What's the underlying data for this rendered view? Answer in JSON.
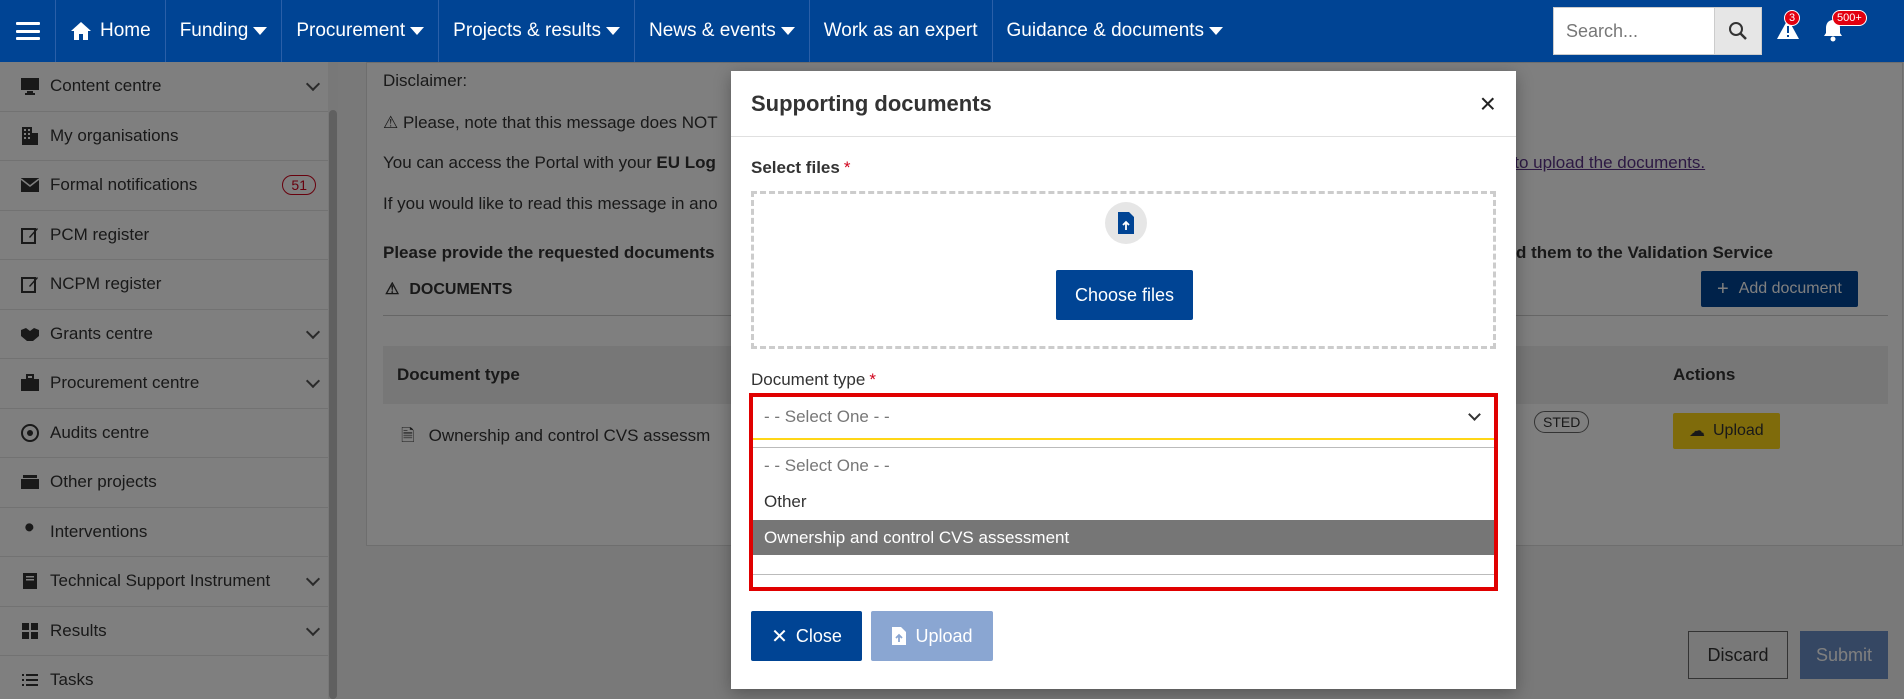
{
  "topnav": {
    "home": "Home",
    "items": [
      "Funding",
      "Procurement",
      "Projects & results",
      "News & events",
      "Work as an expert",
      "Guidance & documents"
    ],
    "search_placeholder": "Search...",
    "alerts_count": "3",
    "notifications_count": "500+"
  },
  "sidebar": {
    "items": [
      {
        "label": "Content centre",
        "icon": "monitor-icon"
      },
      {
        "label": "My organisations",
        "icon": "building-icon"
      },
      {
        "label": "Formal notifications",
        "icon": "envelope-icon",
        "badge": "51"
      },
      {
        "label": "PCM register",
        "icon": "edit-icon"
      },
      {
        "label": "NCPM register",
        "icon": "edit-icon"
      },
      {
        "label": "Grants centre",
        "icon": "handshake-icon"
      },
      {
        "label": "Procurement centre",
        "icon": "briefcase-icon"
      },
      {
        "label": "Audits centre",
        "icon": "target-icon"
      },
      {
        "label": "Other projects",
        "icon": "stack-icon"
      },
      {
        "label": "Interventions",
        "icon": "wrench-icon"
      },
      {
        "label": "Technical Support Instrument",
        "icon": "book-icon"
      },
      {
        "label": "Results",
        "icon": "grid-icon"
      },
      {
        "label": "Tasks",
        "icon": "list-icon"
      }
    ]
  },
  "background": {
    "disclaimer": "Disclaimer:",
    "line1": "⚠ Please, note that this message does NOT",
    "line2_prefix": "You can access the Portal with your ",
    "line2_bold": "EU Log",
    "line2_link": "k to upload the documents.",
    "line3": "If you would like to read this message in ano",
    "request_bold_left": "Please provide the requested documents",
    "request_bold_right": "d them to the Validation Service",
    "documents_heading": "DOCUMENTS",
    "add_document": "Add document",
    "table_col1": "Document type",
    "table_col_actions": "Actions",
    "row_doc": "Ownership and control CVS assessm",
    "row_status": "STED",
    "row_upload": "Upload",
    "discard": "Discard",
    "submit": "Submit"
  },
  "modal": {
    "title": "Supporting documents",
    "select_files_label": "Select files",
    "choose_files": "Choose files",
    "document_type_label": "Document type",
    "select_value": "- - Select One - -",
    "options": [
      "- - Select One - -",
      "Other",
      "Ownership and control CVS assessment"
    ],
    "selected_index": 2,
    "close": "Close",
    "upload": "Upload"
  }
}
